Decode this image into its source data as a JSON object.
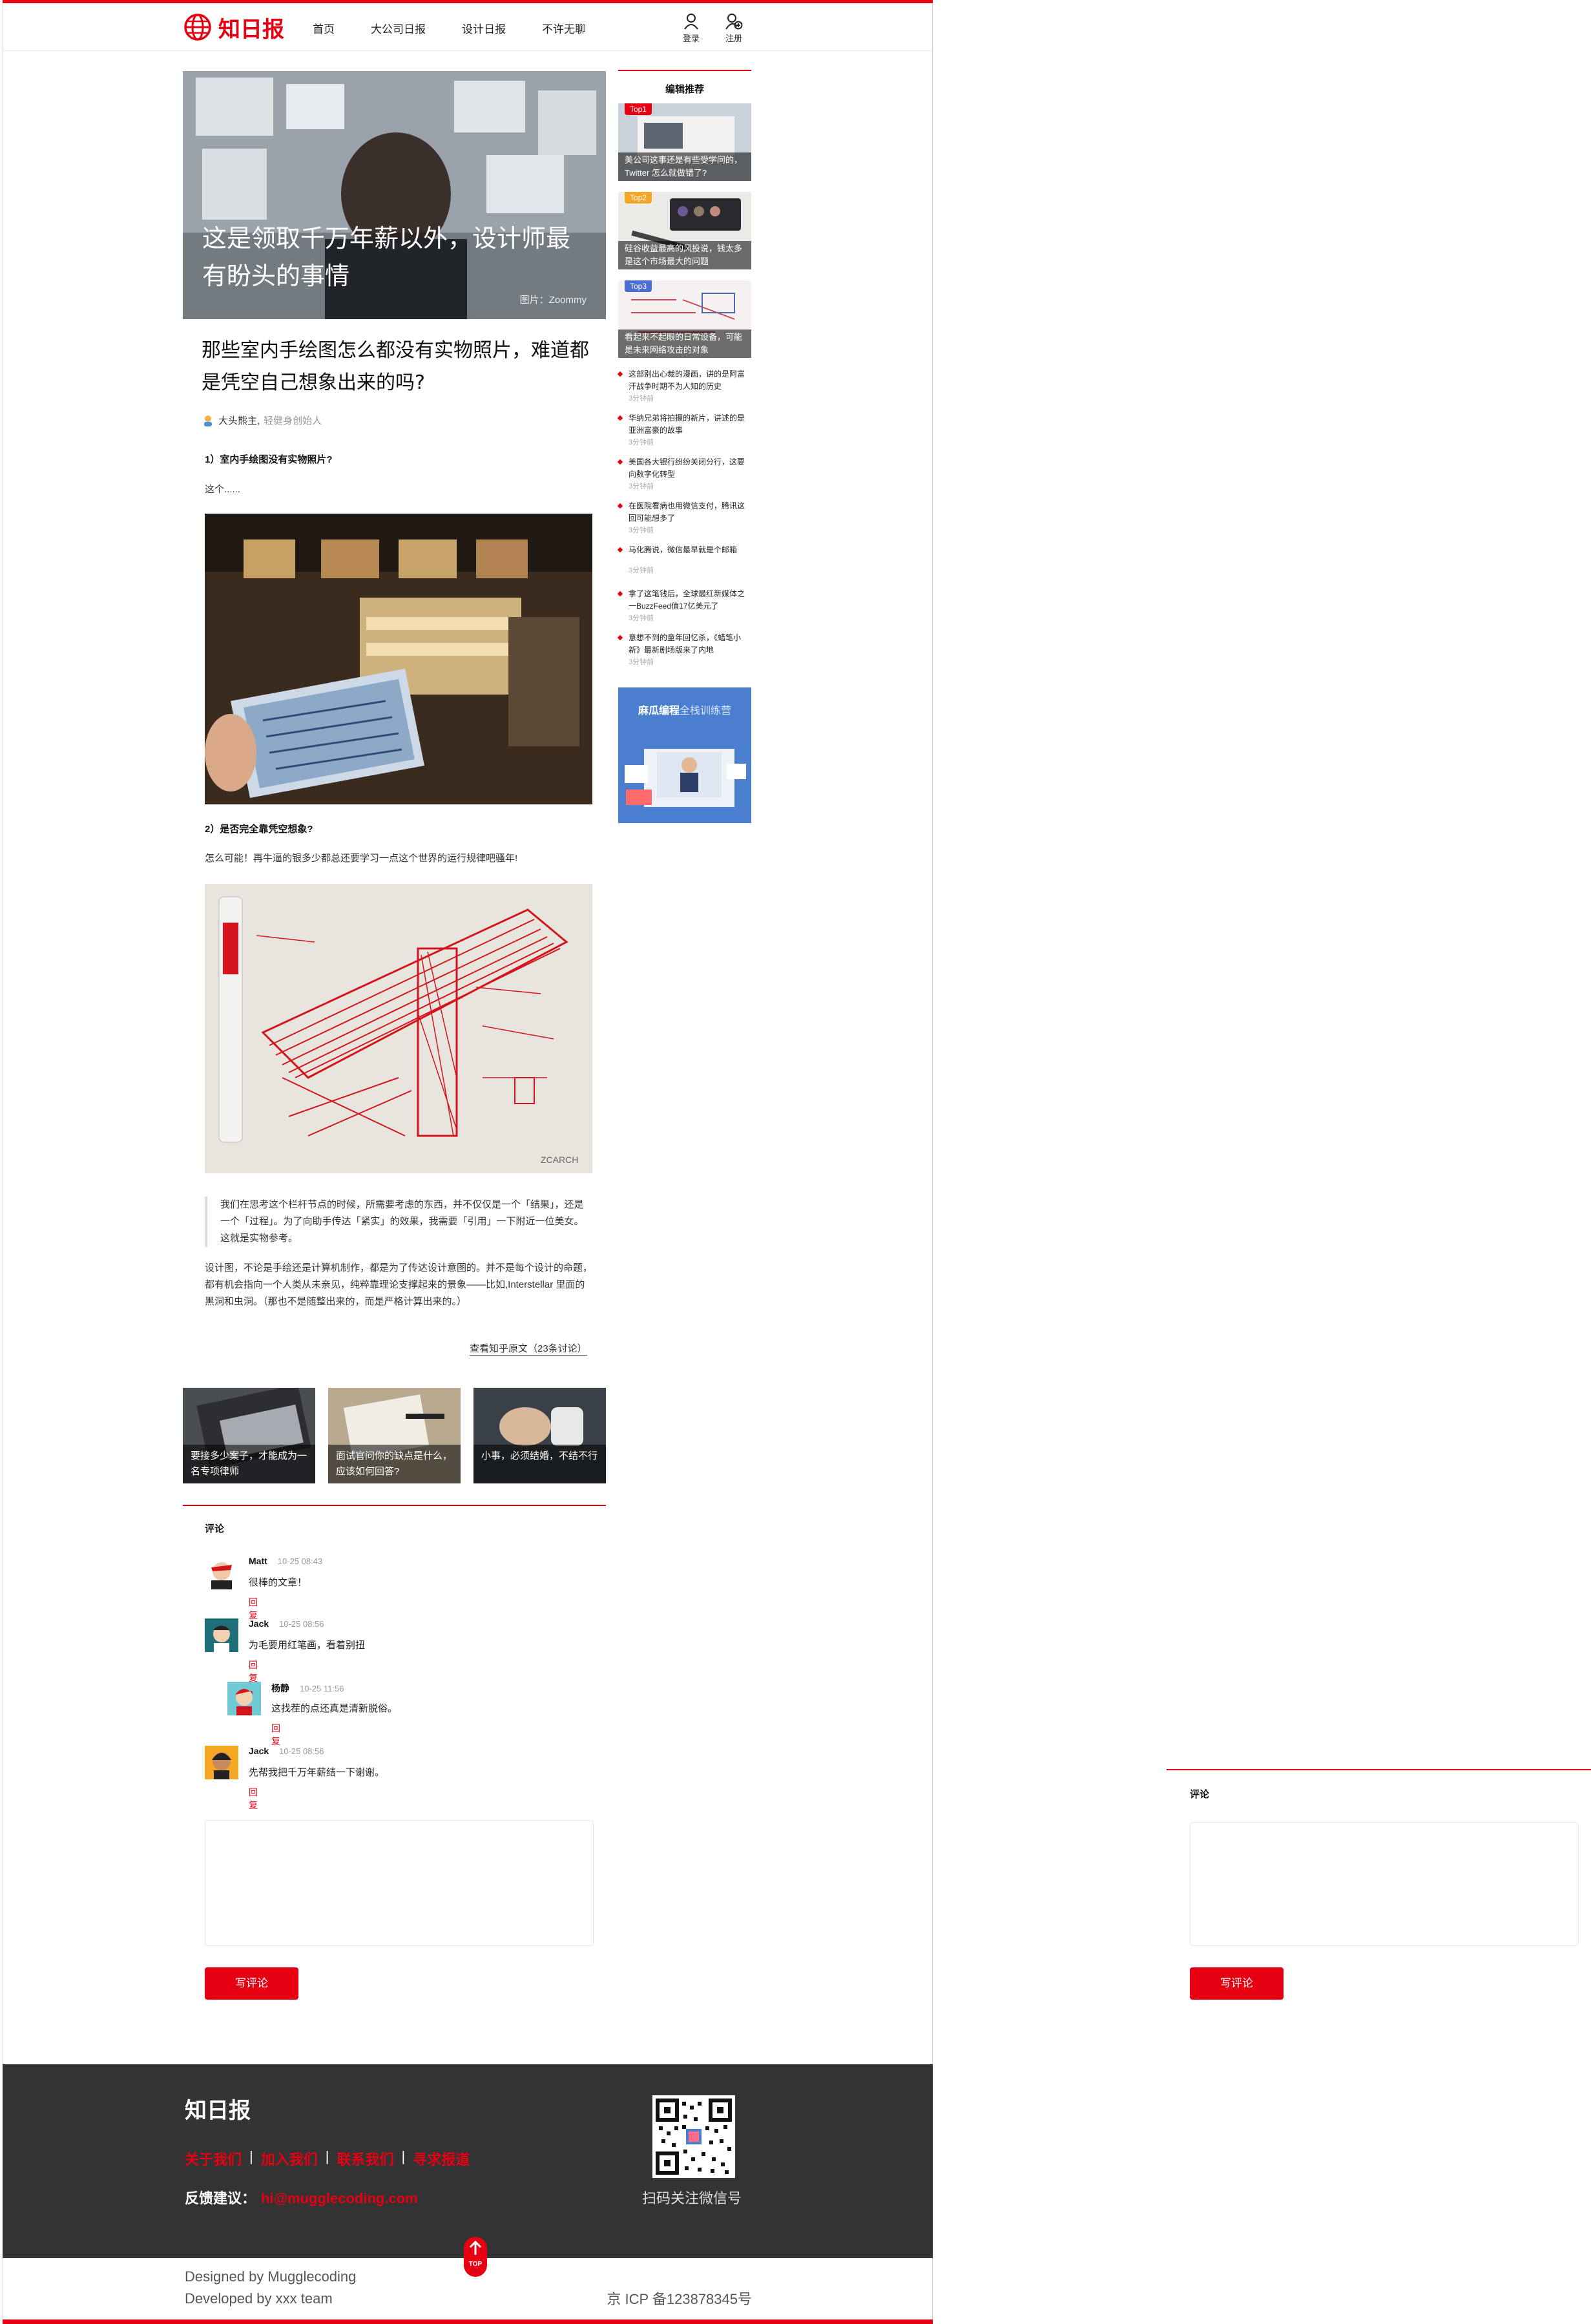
{
  "header": {
    "logo_text": "知日报",
    "nav": [
      "首页",
      "大公司日报",
      "设计日报",
      "不许无聊"
    ],
    "login_label": "登录",
    "register_label": "注册"
  },
  "hero": {
    "title": "这是领取千万年薪以外，设计师最有盼头的事情",
    "credit": "图片：Zoommy"
  },
  "article": {
    "title": "那些室内手绘图怎么都没有实物照片，难道都是凭空自己想象出来的吗?",
    "author": "大头熊主,",
    "author_bio": "轻健身创始人",
    "q1": "1）室内手绘图没有实物照片?",
    "a1": "这个......",
    "q2": "2）是否完全靠凭空想象?",
    "a2": "怎么可能！再牛逼的银多少都总还要学习一点这个世界的运行规律吧骚年!",
    "quote": "我们在思考这个栏杆节点的时候，所需要考虑的东西，并不仅仅是一个「结果」，还是一个「过程」。为了向助手传达「紧实」的效果，我需要「引用」一下附近一位美女。这就是实物参考。",
    "para": "设计图，不论是手绘还是计算机制作，都是为了传达设计意图的。并不是每个设计的命题，都有机会指向一个人类从未亲见，纯粹靠理论支撑起来的景象——比如,Interstellar 里面的黑洞和虫洞。（那也不是随整出来的，而是严格计算出来的。）",
    "source_link": "查看知乎原文（23条讨论）"
  },
  "related": [
    "要接多少案子，才能成为一名专项律师",
    "面试官问你的缺点是什么，应该如何回答?",
    "小事，必须结婚，不结不行"
  ],
  "comments": {
    "title": "评论",
    "reply_label": "回复",
    "items": [
      {
        "name": "Matt",
        "time": "10-25 08:43",
        "text": "很棒的文章！"
      },
      {
        "name": "Jack",
        "time": "10-25 08:56",
        "text": "为毛要用红笔画，看着别扭"
      },
      {
        "name": "杨静",
        "time": "10-25 11:56",
        "text": "这找茬的点还真是清新脱俗。"
      },
      {
        "name": "Jack",
        "time": "10-25 08:56",
        "text": "先帮我把千万年薪结一下谢谢。"
      }
    ],
    "button_label": "写评论"
  },
  "sidebar": {
    "title": "编辑推荐",
    "cards": [
      {
        "badge": "Top1",
        "caption": "美公司这事还是有些受学问的，Twitter 怎么就做错了?"
      },
      {
        "badge": "Top2",
        "caption": "硅谷收益最高的风投说，钱太多是这个市场最大的问题"
      },
      {
        "badge": "Top3",
        "caption": "看起来不起眼的日常设备，可能是未来网络攻击的对象"
      }
    ],
    "news": [
      {
        "text": "这部别出心裁的漫画，讲的是阿富汗战争时期不为人知的历史",
        "ago": "3分钟前"
      },
      {
        "text": "华纳兄弟将拍摄的新片，讲述的是亚洲富豪的故事",
        "ago": "3分钟前"
      },
      {
        "text": "美国各大银行纷纷关闭分行，这要向数字化转型",
        "ago": "3分钟前"
      },
      {
        "text": "在医院看病也用微信支付，腾讯这回可能想多了",
        "ago": "3分钟前"
      },
      {
        "text": "马化腾说，微信最早就是个邮箱",
        "ago": "3分钟前"
      },
      {
        "text": "拿了这笔钱后，全球最红新媒体之一BuzzFeed值17亿美元了",
        "ago": "3分钟前"
      },
      {
        "text": "意想不到的童年回忆杀，《蜡笔小新》最新剧场版来了内地",
        "ago": "3分钟前"
      }
    ],
    "ad_title": "麻瓜编程",
    "ad_sub": "全栈训练营"
  },
  "footer": {
    "logo": "知日报",
    "links": [
      "关于我们",
      "加入我们",
      "联系我们",
      "寻求报道"
    ],
    "feedback_label": "反馈建议：",
    "email": "hi@mugglecoding.com",
    "qr_caption": "扫码关注微信号",
    "designed_by": "Designed by Mugglecoding",
    "developed_by": "Developed by xxx team",
    "icp": "京 ICP 备123878345号",
    "top_label": "TOP"
  },
  "right_panel": {
    "title": "评论",
    "button_label": "写评论"
  },
  "colors": {
    "accent": "#e60012",
    "footer_bg": "#333333"
  }
}
